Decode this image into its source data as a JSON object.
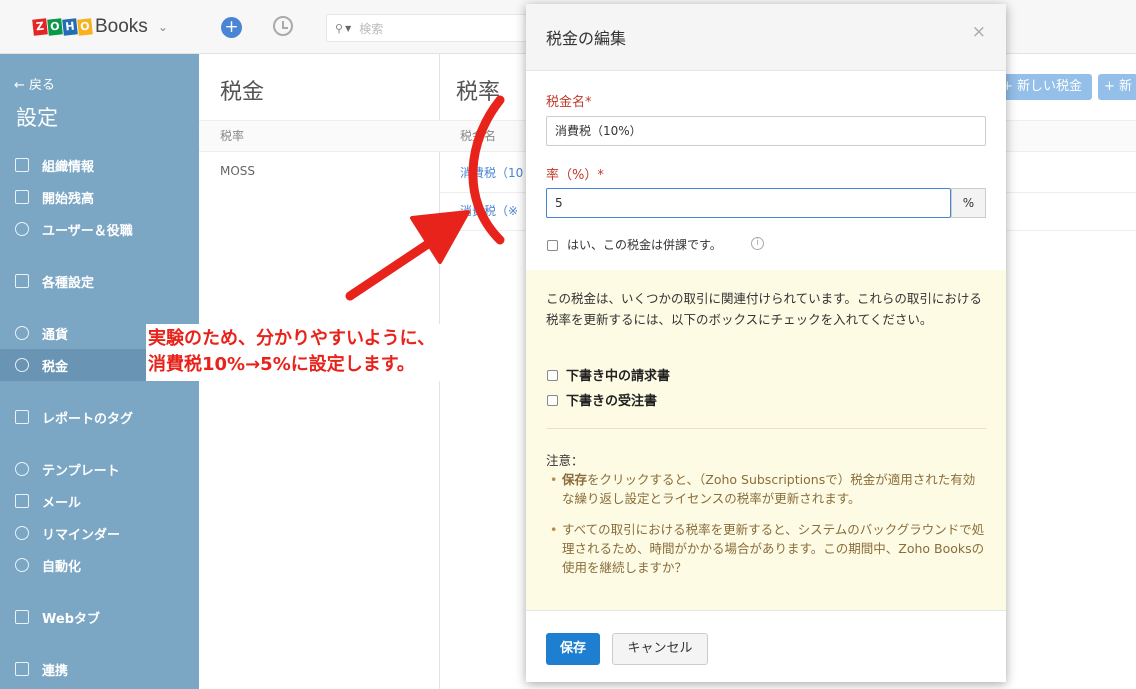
{
  "header": {
    "logo_letters": [
      "Z",
      "O",
      "H",
      "O"
    ],
    "logo_colors": [
      "#e42527",
      "#089949",
      "#226db4",
      "#f9b21d"
    ],
    "logo_text": "Books",
    "search_placeholder": "検索"
  },
  "sidebar": {
    "back_label": "← 戻る",
    "title": "設定",
    "items": [
      {
        "label": "組織情報"
      },
      {
        "label": "開始残高"
      },
      {
        "label": "ユーザー＆役職"
      },
      {
        "label": "各種設定"
      },
      {
        "label": "通貨"
      },
      {
        "label": "税金",
        "active": true
      },
      {
        "label": "レポートのタグ"
      },
      {
        "label": "テンプレート"
      },
      {
        "label": "メール"
      },
      {
        "label": "リマインダー"
      },
      {
        "label": "自動化"
      },
      {
        "label": "Webタブ"
      },
      {
        "label": "連携"
      }
    ]
  },
  "middle": {
    "title": "税金",
    "column": "税率",
    "rows": [
      "MOSS"
    ]
  },
  "content": {
    "title": "税率",
    "column": "税金名",
    "rows": [
      "消費税（10",
      "消費税（※"
    ],
    "new_tax_button": "+ 新しい税金",
    "new_button_partial": "+ 新"
  },
  "modal": {
    "title": "税金の編集",
    "close": "×",
    "tax_name_label": "税金名*",
    "tax_name_value": "消費税（10%）",
    "rate_label": "率（%）*",
    "rate_value": "5",
    "rate_unit": "%",
    "compound_label": "はい、この税金は併課です。",
    "notice_text": "この税金は、いくつかの取引に関連付けられています。これらの取引における税率を更新するには、以下のボックスにチェックを入れてください。",
    "draft_invoices_label": "下書き中の請求書",
    "draft_sales_orders_label": "下書きの受注書",
    "note_title": "注意：",
    "bullet1_bold": "保存",
    "bullet1_rest": "をクリックすると、（Zoho Subscriptionsで）税金が適用された有効な繰り返し設定とライセンスの税率が更新されます。",
    "bullet2": "すべての取引における税率を更新すると、システムのバックグラウンドで処理されるため、時間がかかる場合があります。この期間中、Zoho Booksの使用を継続しますか？",
    "save_button": "保存",
    "cancel_button": "キャンセル"
  },
  "annotation": {
    "line1": "実験のため、分かりやすいように、",
    "line2": "消費税10%→5%に設定します。",
    "color": "#e8231b"
  }
}
